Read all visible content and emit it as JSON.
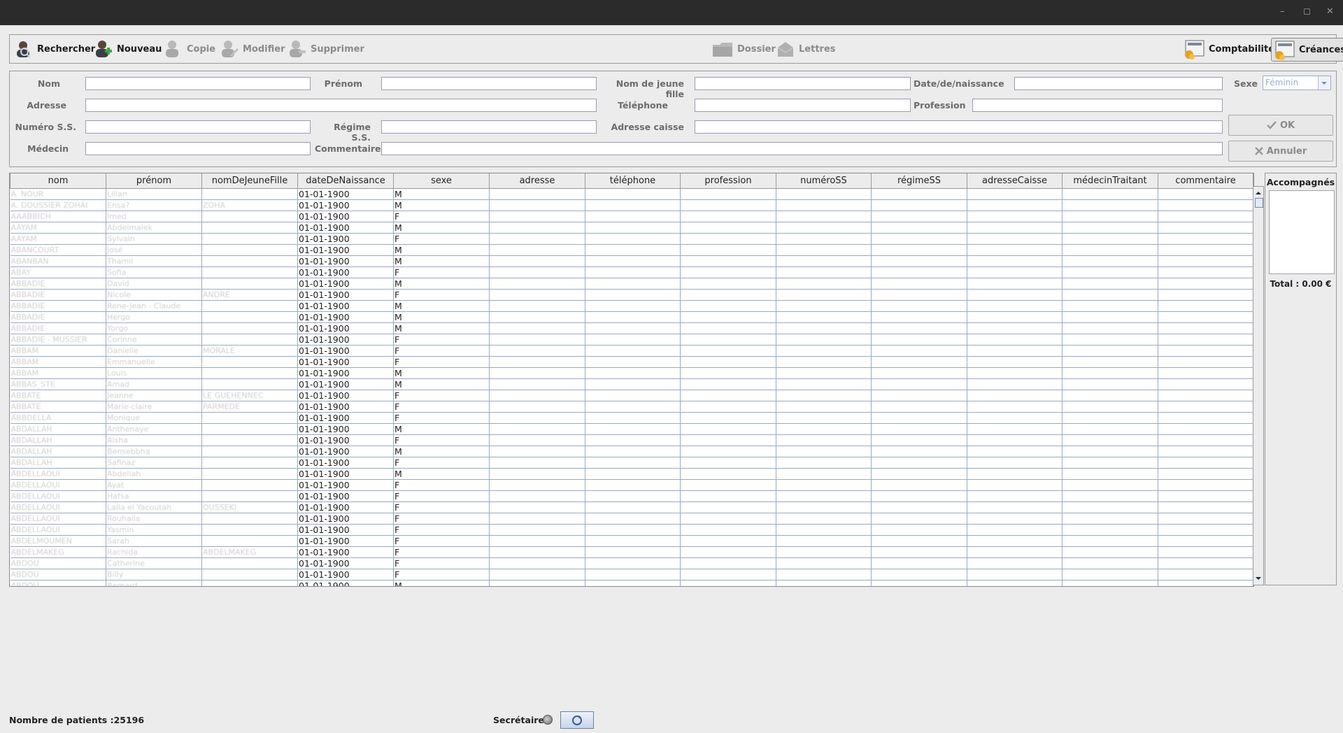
{
  "toolbar": {
    "rechercher": "Rechercher",
    "nouveau": "Nouveau",
    "copie": "Copie",
    "modifier": "Modifier",
    "supprimer": "Supprimer",
    "dossier": "Dossier",
    "lettres": "Lettres",
    "comptabilite": "Comptabilité",
    "creances": "Créances"
  },
  "form": {
    "nom": "Nom",
    "prenom": "Prénom",
    "nom_jeune_fille": "Nom de jeune fille",
    "date_naissance": "Date/de/naissance",
    "sexe": "Sexe",
    "sexe_value": "Féminin",
    "adresse": "Adresse",
    "telephone": "Téléphone",
    "profession": "Profession",
    "numero_ss": "Numéro S.S.",
    "regime_ss": "Régime S.S.",
    "adresse_caisse": "Adresse caisse",
    "medecin": "Médecin",
    "commentaire": "Commentaire",
    "ok": "OK",
    "annuler": "Annuler"
  },
  "table": {
    "columns": [
      "nom",
      "prénom",
      "nomDeJeuneFille",
      "dateDeNaissance",
      "sexe",
      "adresse",
      "téléphone",
      "profession",
      "numéroSS",
      "régimeSS",
      "adresseCaisse",
      "médecinTraitant",
      "commentaire"
    ],
    "rows": [
      {
        "nom": "A. NOUR",
        "prenom": "Lilian",
        "njf": "",
        "date": "01-01-1900",
        "sexe": "M"
      },
      {
        "nom": "A. DOUSSIER ZOHAI",
        "prenom": "Ensa?",
        "njf": "ZOHA",
        "date": "01-01-1900",
        "sexe": "M"
      },
      {
        "nom": "AAABBICH",
        "prenom": "Imed",
        "njf": "",
        "date": "01-01-1900",
        "sexe": "F"
      },
      {
        "nom": "AAYAM",
        "prenom": "Abdelmalek",
        "njf": "",
        "date": "01-01-1900",
        "sexe": "M"
      },
      {
        "nom": "AAYAM",
        "prenom": "Sylvain",
        "njf": "",
        "date": "01-01-1900",
        "sexe": "F"
      },
      {
        "nom": "ABANCOURT",
        "prenom": "José",
        "njf": "",
        "date": "01-01-1900",
        "sexe": "M"
      },
      {
        "nom": "ABANBAN",
        "prenom": "Thamil",
        "njf": "",
        "date": "01-01-1900",
        "sexe": "M"
      },
      {
        "nom": "ABAY",
        "prenom": "Sofia",
        "njf": "",
        "date": "01-01-1900",
        "sexe": "F"
      },
      {
        "nom": "ABBADIE",
        "prenom": "David",
        "njf": "",
        "date": "01-01-1900",
        "sexe": "M"
      },
      {
        "nom": "ABBADIE",
        "prenom": "Nicole",
        "njf": "ANDRÉ",
        "date": "01-01-1900",
        "sexe": "F"
      },
      {
        "nom": "ABBADIE",
        "prenom": "Rene-Jean - Claude",
        "njf": "",
        "date": "01-01-1900",
        "sexe": "M"
      },
      {
        "nom": "ABBADIE",
        "prenom": "Hergo",
        "njf": "",
        "date": "01-01-1900",
        "sexe": "M"
      },
      {
        "nom": "ABBADIE",
        "prenom": "Yorgo",
        "njf": "",
        "date": "01-01-1900",
        "sexe": "M"
      },
      {
        "nom": "ABBADIE - MUSSIER",
        "prenom": "Corinne",
        "njf": "",
        "date": "01-01-1900",
        "sexe": "F"
      },
      {
        "nom": "ABBAM",
        "prenom": "Danielle",
        "njf": "MORALE",
        "date": "01-01-1900",
        "sexe": "F"
      },
      {
        "nom": "ABBAM",
        "prenom": "Emmanuelle",
        "njf": "",
        "date": "01-01-1900",
        "sexe": "F"
      },
      {
        "nom": "ABBAM",
        "prenom": "Louis",
        "njf": "",
        "date": "01-01-1900",
        "sexe": "M"
      },
      {
        "nom": "ABBAS_STE",
        "prenom": "Amad",
        "njf": "",
        "date": "01-01-1900",
        "sexe": "M"
      },
      {
        "nom": "ABBATE",
        "prenom": "Jeanne",
        "njf": "LE GUEHENNEC",
        "date": "01-01-1900",
        "sexe": "F"
      },
      {
        "nom": "ABBATE",
        "prenom": "Marie-claire",
        "njf": "PARMEDE",
        "date": "01-01-1900",
        "sexe": "F"
      },
      {
        "nom": "ABBDELLA",
        "prenom": "Monique",
        "njf": "",
        "date": "01-01-1900",
        "sexe": "F"
      },
      {
        "nom": "ABDALLAH",
        "prenom": "Anthenaye",
        "njf": "",
        "date": "01-01-1900",
        "sexe": "M"
      },
      {
        "nom": "ABDALLAH",
        "prenom": "Aisha",
        "njf": "",
        "date": "01-01-1900",
        "sexe": "F"
      },
      {
        "nom": "ABDALLAH",
        "prenom": "Bensebbha",
        "njf": "",
        "date": "01-01-1900",
        "sexe": "M"
      },
      {
        "nom": "ABDALLAH",
        "prenom": "Safinaz",
        "njf": "",
        "date": "01-01-1900",
        "sexe": "F"
      },
      {
        "nom": "ABDELLAOUI",
        "prenom": "Abdellah",
        "njf": "",
        "date": "01-01-1900",
        "sexe": "M"
      },
      {
        "nom": "ABDELLAOUI",
        "prenom": "Ayat",
        "njf": "",
        "date": "01-01-1900",
        "sexe": "F"
      },
      {
        "nom": "ABDELLAOUI",
        "prenom": "Hafsa",
        "njf": "",
        "date": "01-01-1900",
        "sexe": "F"
      },
      {
        "nom": "ABDELLAOUI",
        "prenom": "Lalla el Yacoutah",
        "njf": "OUSSEKI",
        "date": "01-01-1900",
        "sexe": "F"
      },
      {
        "nom": "ABDELLAOUI",
        "prenom": "Rouhaila",
        "njf": "",
        "date": "01-01-1900",
        "sexe": "F"
      },
      {
        "nom": "ABDELLAOUI",
        "prenom": "Yasmin",
        "njf": "",
        "date": "01-01-1900",
        "sexe": "F"
      },
      {
        "nom": "ABDELMOUMEN",
        "prenom": "Sarah",
        "njf": "",
        "date": "01-01-1900",
        "sexe": "F"
      },
      {
        "nom": "ABDELMAKEG",
        "prenom": "Rachida",
        "njf": "ABDELMAKEG",
        "date": "01-01-1900",
        "sexe": "F"
      },
      {
        "nom": "ABDOU",
        "prenom": "Catherine",
        "njf": "",
        "date": "01-01-1900",
        "sexe": "F"
      },
      {
        "nom": "ABDOU",
        "prenom": "Billy",
        "njf": "",
        "date": "01-01-1900",
        "sexe": "F"
      },
      {
        "nom": "ABDOU",
        "prenom": "Bernard",
        "njf": "",
        "date": "01-01-1900",
        "sexe": "M"
      }
    ]
  },
  "side": {
    "title": "Accompagnés",
    "total": "Total :  0.00 €"
  },
  "status": {
    "count": "Nombre de patients :25196",
    "secretaire": "Secrétaire"
  }
}
